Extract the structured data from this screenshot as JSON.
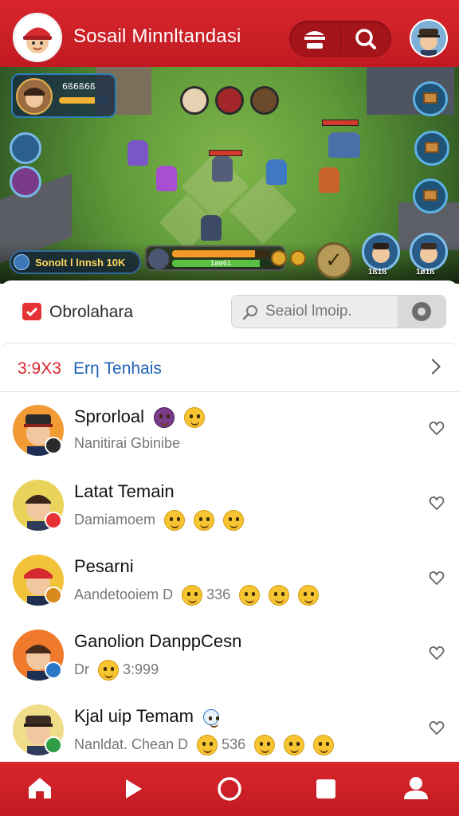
{
  "header": {
    "app_title": "Sosail Minnltandasi",
    "pill_left_icon": "menu-icon",
    "pill_right_icon": "search-icon",
    "logo_icon": "character-logo",
    "avatar_icon": "profile-avatar"
  },
  "game": {
    "hero_name": "6ß6ß6ß",
    "hero_bar_level": 0.7,
    "score_text": "Sonolt l lnnsh 10K",
    "bar_label": "1øø61",
    "orange_bar_level": 0.85,
    "green_bar_level": 0.9,
    "player1_score": "1ß1ß",
    "player2_score": "1ø1ß",
    "confirm_icon": "check-icon"
  },
  "chat": {
    "title": "Obrolahara",
    "search_placeholder": "Seaiol lmoip.",
    "section_count": "3:9X3",
    "section_label": "Erη Tenhais",
    "items": [
      {
        "name": "Sprorloal",
        "preview": "Nanitirai Gbinibe",
        "status_color": "#2b2b2b",
        "avatar_bg": "#f29b35"
      },
      {
        "name": "Latat Temain",
        "preview": "Damiamoem",
        "status_color": "#e53235",
        "avatar_bg": "#e9d35a"
      },
      {
        "name": "Pesarni",
        "preview": "Aandetooiem D",
        "preview_num": "336",
        "status_color": "#d98a1d",
        "avatar_bg": "#f2c23b"
      },
      {
        "name": "Ganolion DanppCesn",
        "preview": "Dr",
        "preview_num": "3:999",
        "status_color": "#2b78c9",
        "avatar_bg": "#ef7a2b"
      },
      {
        "name": "Kjal uip Temam",
        "preview": "Nanldat. Chean D",
        "preview_num": "536",
        "status_color": "#2f9d46",
        "avatar_bg": "#f0dd8a"
      }
    ]
  },
  "nav": {
    "items": [
      {
        "icon": "home-icon"
      },
      {
        "icon": "play-icon"
      },
      {
        "icon": "record-icon"
      },
      {
        "icon": "square-icon"
      },
      {
        "icon": "profile-icon"
      }
    ]
  },
  "colors": {
    "brand_red": "#d8262d",
    "link_blue": "#1f63b5"
  }
}
